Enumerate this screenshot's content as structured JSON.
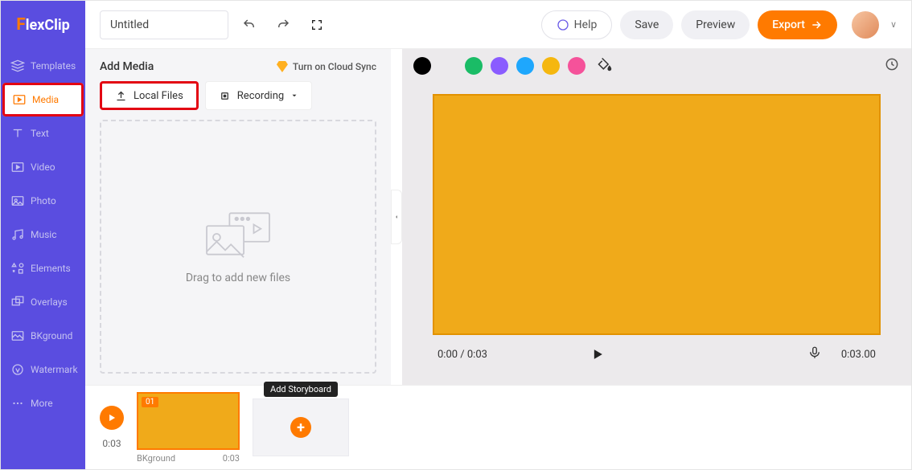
{
  "brand": {
    "f": "F",
    "rest": "lexClip"
  },
  "sidebar": {
    "items": [
      {
        "label": "Templates",
        "name": "templates"
      },
      {
        "label": "Media",
        "name": "media"
      },
      {
        "label": "Text",
        "name": "text"
      },
      {
        "label": "Video",
        "name": "video"
      },
      {
        "label": "Photo",
        "name": "photo"
      },
      {
        "label": "Music",
        "name": "music"
      },
      {
        "label": "Elements",
        "name": "elements"
      },
      {
        "label": "Overlays",
        "name": "overlays"
      },
      {
        "label": "BKground",
        "name": "bkground"
      },
      {
        "label": "Watermark",
        "name": "watermark"
      },
      {
        "label": "More",
        "name": "more"
      }
    ]
  },
  "top": {
    "title_value": "Untitled",
    "help": "Help",
    "save": "Save",
    "preview": "Preview",
    "export": "Export"
  },
  "media_panel": {
    "title": "Add Media",
    "cloud_sync": "Turn on Cloud Sync",
    "local_files": "Local Files",
    "recording": "Recording",
    "dropzone_text": "Drag to add new files"
  },
  "canvas": {
    "colors": {
      "black": "#000000",
      "green": "#1abc66",
      "purple": "#8a5cff",
      "blue": "#1ea7fd",
      "yellow": "#f5b70f",
      "pink": "#f5529a"
    },
    "time_current": "0:00 / 0:03",
    "time_total": "0:03.00"
  },
  "timeline": {
    "play_time": "0:03",
    "clip_badge": "01",
    "clip_name": "BKground",
    "clip_dur": "0:03",
    "add_tooltip": "Add Storyboard"
  }
}
